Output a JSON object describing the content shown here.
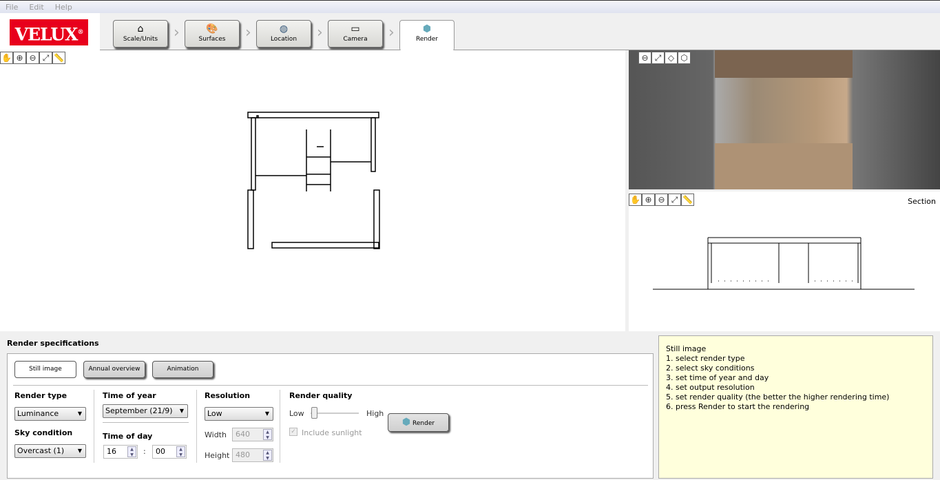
{
  "menu": [
    "File",
    "Edit",
    "Help"
  ],
  "logo": "VELUX",
  "tabs": [
    {
      "label": "Scale/Units",
      "icon": "house-icon"
    },
    {
      "label": "Surfaces",
      "icon": "palette-icon"
    },
    {
      "label": "Location",
      "icon": "globe-icon"
    },
    {
      "label": "Camera",
      "icon": "camera-icon"
    },
    {
      "label": "Render",
      "icon": "render-crystal-icon",
      "active": true
    }
  ],
  "section_label": "Section",
  "specs": {
    "title": "Render specifications",
    "modes": [
      "Still image",
      "Annual overview",
      "Animation"
    ],
    "selected_mode": "Still image",
    "render_type_label": "Render type",
    "render_type": "Luminance",
    "sky_label": "Sky condition",
    "sky": "Overcast (1)",
    "time_year_label": "Time of year",
    "time_year": "September (21/9)",
    "time_day_label": "Time of day",
    "hour": "16",
    "sep": ":",
    "minute": "00",
    "resolution_label": "Resolution",
    "resolution": "Low",
    "width_label": "Width",
    "width": "640",
    "height_label": "Height",
    "height": "480",
    "quality_label": "Render quality",
    "quality_low": "Low",
    "quality_high": "High",
    "quality_value": 0,
    "sunlight_label": "Include sunlight",
    "sunlight_checked": true,
    "render_button": "Render"
  },
  "help": [
    "Still image",
    "1. select render type",
    "2. select sky conditions",
    "3. set time of year and day",
    "4. set output resolution",
    "5. set render quality (the better the higher rendering time)",
    "6. press Render to start the rendering"
  ]
}
